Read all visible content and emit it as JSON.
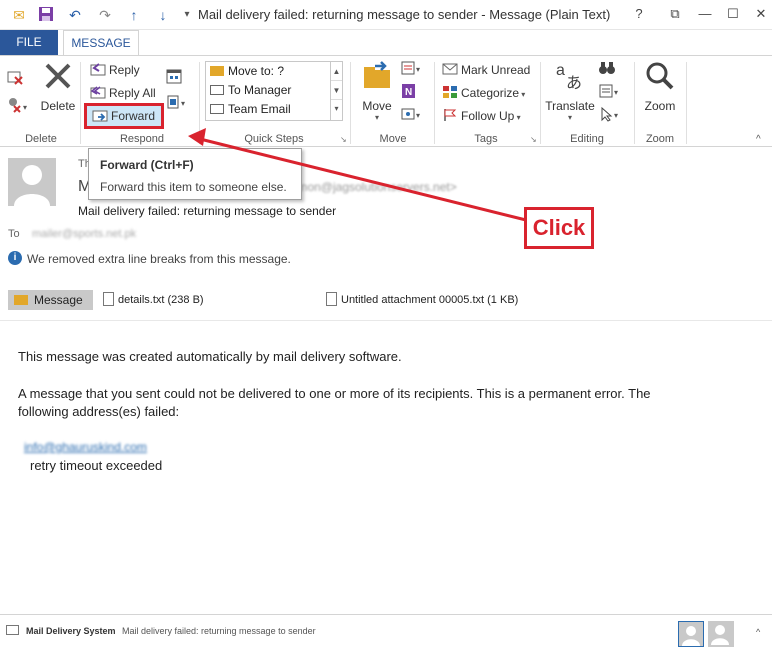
{
  "titlebar": {
    "title": "Mail delivery failed: returning message to sender - Message (Plain Text)",
    "help": "?",
    "restore_ribbon": "⧉",
    "minimize": "—",
    "maximize": "☐",
    "close": "✕"
  },
  "tabs": {
    "file": "FILE",
    "message": "MESSAGE"
  },
  "ribbon": {
    "delete": {
      "label": "Delete",
      "group": "Delete"
    },
    "respond": {
      "reply": "Reply",
      "reply_all": "Reply All",
      "forward": "Forward",
      "group": "Respond"
    },
    "quick_steps": {
      "items": [
        "Move to: ?",
        "To Manager",
        "Team Email"
      ],
      "group": "Quick Steps"
    },
    "move": {
      "label": "Move",
      "group": "Move"
    },
    "tags": {
      "mark_unread": "Mark Unread",
      "categorize": "Categorize",
      "follow_up": "Follow Up",
      "group": "Tags"
    },
    "editing": {
      "translate": "Translate",
      "group": "Editing"
    },
    "zoom": {
      "label": "Zoom",
      "group": "Zoom"
    }
  },
  "tooltip": {
    "title": "Forward (Ctrl+F)",
    "description": "Forward this item to someone else."
  },
  "header": {
    "date_partial": "Th",
    "sender_display": "M",
    "sender_email_obscured": "non@jagsolutionservers.net>",
    "subject": "Mail delivery failed: returning message to sender",
    "to_label": "To",
    "to_value_obscured": "mailer@sports.net.pk",
    "info": "We removed extra line breaks from this message."
  },
  "attachments": {
    "message": "Message",
    "files": [
      "details.txt (238 B)",
      "Untitled attachment 00005.txt (1 KB)"
    ]
  },
  "body": {
    "line1": "This message was created automatically by mail delivery software.",
    "line2": "A message that you sent could not be delivered to one or more of its recipients. This is a permanent error. The",
    "line3": "following address(es) failed:",
    "email_obscured": "info@ghauruskind.com",
    "reason": "retry timeout exceeded"
  },
  "annotation": {
    "click": "Click",
    "color": "#d9232e"
  },
  "statusbar": {
    "sender": "Mail Delivery System",
    "subject": "Mail delivery failed: returning message to sender"
  },
  "colors": {
    "accent": "#2b579a",
    "highlight": "#d9232e",
    "info": "#2b6cb0"
  }
}
